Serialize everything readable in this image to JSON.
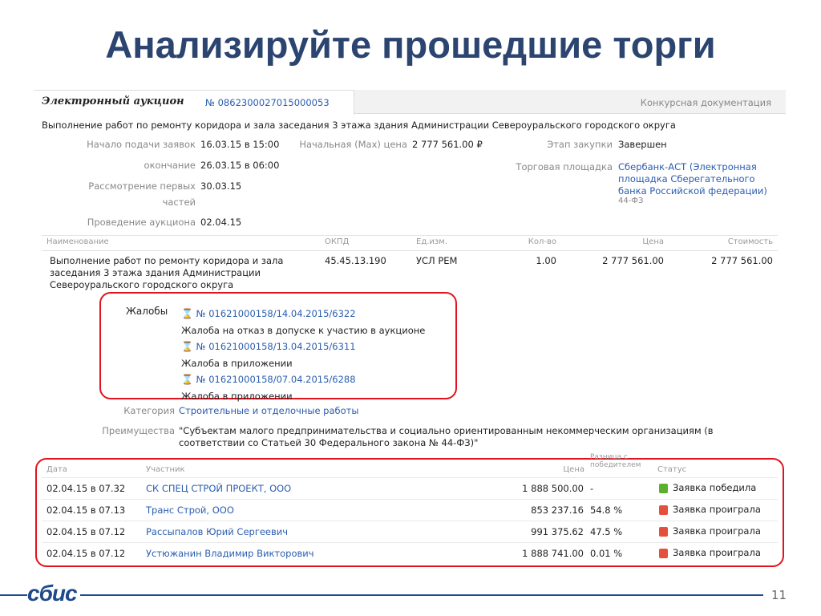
{
  "slide": {
    "title": "Анализируйте прошедшие торги",
    "page": "11",
    "logo": "сбис"
  },
  "auction": {
    "type": "Электронный аукцион",
    "number": "№ 0862300027015000053",
    "docs_tab": "Конкурсная документация",
    "subject": "Выполнение работ по ремонту коридора и зала заседания 3 этажа здания Администрации Североуральского городского округа",
    "start_label": "Начало подачи заявок",
    "start": "16.03.15 в 15:00",
    "end_label": "окончание",
    "end": "26.03.15 в 06:00",
    "review_label1": "Рассмотрение первых",
    "review_label2": "частей",
    "review": "30.03.15",
    "auction_label": "Проведение аукциона",
    "auction_date": "02.04.15",
    "price_label": "Начальная (Max) цена",
    "price": "2 777 561.00 ₽",
    "stage_label": "Этап закупки",
    "stage": "Завершен",
    "platform_label": "Торговая площадка",
    "platform1": "Сбербанк-АСТ (Электронная",
    "platform2": "площадка Сберегательного",
    "platform3": "банка Российской федерации)",
    "law": "44-ФЗ"
  },
  "items": {
    "headers": [
      "Наименование",
      "ОКПД",
      "Ед.изм.",
      "Кол-во",
      "Цена",
      "Стоимость"
    ],
    "row": {
      "name1": "Выполнение работ по ремонту коридора и зала",
      "name2": "заседания 3 этажа здания Администрации",
      "name3": "Североуральского городского округа",
      "okpd": "45.45.13.190",
      "unit": "УСЛ РЕМ",
      "qty": "1.00",
      "price": "2 777 561.00",
      "cost": "2 777 561.00"
    }
  },
  "complaints": {
    "label": "Жалобы",
    "list": [
      {
        "num": "№ 01621000158/14.04.2015/6322",
        "text": "Жалоба на отказ в допуске к участию в аукционе"
      },
      {
        "num": "№ 01621000158/13.04.2015/6311",
        "text": "Жалоба в приложении"
      },
      {
        "num": "№ 01621000158/07.04.2015/6288",
        "text": "Жалоба в приложении"
      }
    ]
  },
  "category": {
    "label": "Категория",
    "value": "Строительные и отделочные работы"
  },
  "advantages": {
    "label": "Преимущества",
    "line1": "\"Субъектам малого предпринимательства и социально ориентированным некоммерческим организациям (в",
    "line2": "соответствии со Статьей 30 Федерального закона № 44-ФЗ)\""
  },
  "bids": {
    "headers": {
      "date": "Дата",
      "participant": "Участник",
      "price": "Цена",
      "diff1": "Разница с",
      "diff2": "победителем",
      "status": "Статус"
    },
    "rows": [
      {
        "date": "02.04.15 в 07.32",
        "participant": "СК СПЕЦ СТРОЙ ПРОЕКТ, ООО",
        "price": "1 888 500.00",
        "diff": "-",
        "status": "Заявка победила",
        "win": true
      },
      {
        "date": "02.04.15 в 07.13",
        "participant": "Транс Строй, ООО",
        "price": "853 237.16",
        "diff": "54.8 %",
        "status": "Заявка проиграла",
        "win": false
      },
      {
        "date": "02.04.15 в 07.12",
        "participant": "Рассыпалов Юрий Сергеевич",
        "price": "991 375.62",
        "diff": "47.5 %",
        "status": "Заявка проиграла",
        "win": false
      },
      {
        "date": "02.04.15 в 07.12",
        "participant": "Устюжанин Владимир Викторович",
        "price": "1 888 741.00",
        "diff": "0.01 %",
        "status": "Заявка проиграла",
        "win": false
      }
    ]
  }
}
